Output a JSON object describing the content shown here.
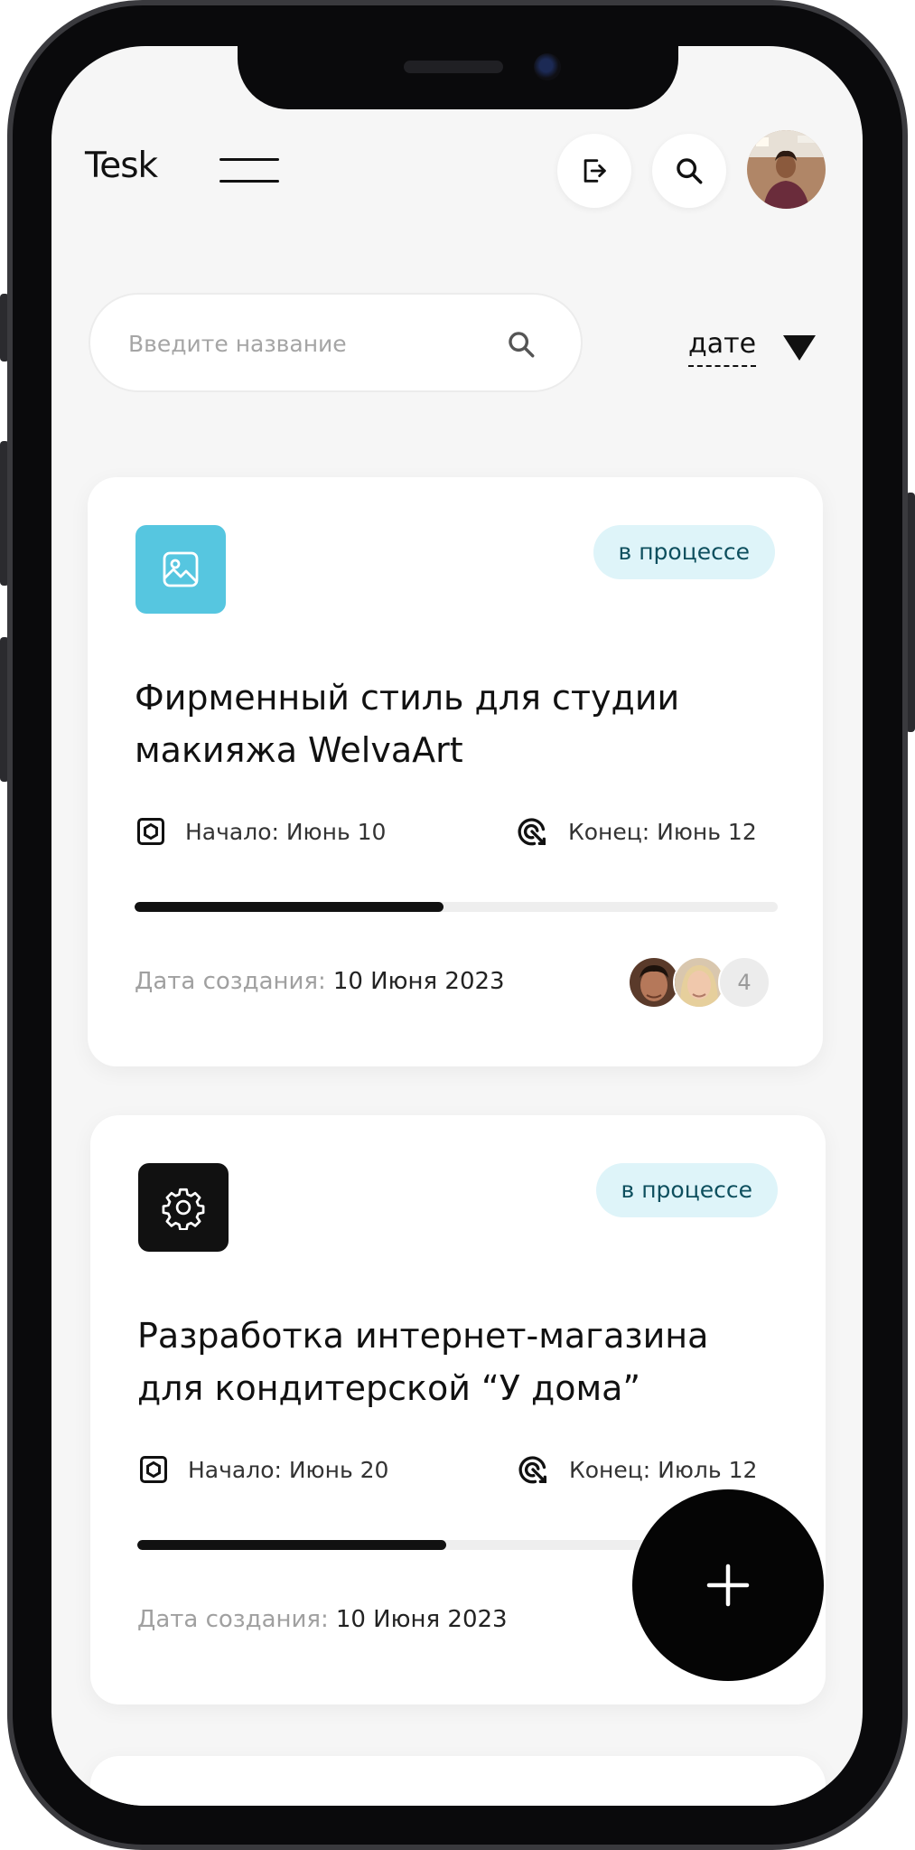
{
  "header": {
    "logo": "Tesk"
  },
  "search": {
    "placeholder": "Введите название",
    "sort_label": "дате"
  },
  "projects": [
    {
      "status": "в процессе",
      "title_line1": "Фирменный стиль для студии",
      "title_line2": "макияжа WelvaArt",
      "start": "Начало: Июнь 10",
      "end": "Конец: Июнь 12",
      "progress": 0.48,
      "created_label": "Дата создания:",
      "created_value": "10 Июня 2023",
      "extra_members": "4",
      "icon": "image-icon",
      "icon_bg": "#56c6e0"
    },
    {
      "status": "в процессе",
      "title_line1": "Разработка интернет-магазина",
      "title_line2": "для кондитерской “У дома”",
      "start": "Начало: Июнь 20",
      "end": "Конец: Июль 12",
      "progress": 0.48,
      "created_label": "Дата создания:",
      "created_value": "10 Июня 2023",
      "icon": "gear-icon",
      "icon_bg": "#111111"
    }
  ],
  "colors": {
    "badge_bg": "#def4f9",
    "badge_text": "#0d4f5e",
    "background": "#f6f6f6"
  }
}
